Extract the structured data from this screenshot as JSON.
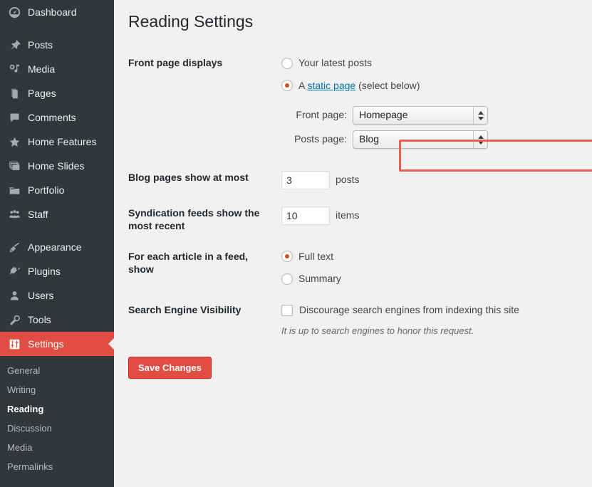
{
  "sidebar": {
    "items": [
      {
        "label": "Dashboard",
        "icon": "dashboard-icon"
      },
      {
        "label": "Posts",
        "icon": "pin-icon"
      },
      {
        "label": "Media",
        "icon": "media-icon"
      },
      {
        "label": "Pages",
        "icon": "pages-icon"
      },
      {
        "label": "Comments",
        "icon": "comment-icon"
      },
      {
        "label": "Home Features",
        "icon": "star-icon"
      },
      {
        "label": "Home Slides",
        "icon": "images-icon"
      },
      {
        "label": "Portfolio",
        "icon": "folder-icon"
      },
      {
        "label": "Staff",
        "icon": "group-icon"
      },
      {
        "label": "Appearance",
        "icon": "paintbrush-icon"
      },
      {
        "label": "Plugins",
        "icon": "plug-icon"
      },
      {
        "label": "Users",
        "icon": "user-icon"
      },
      {
        "label": "Tools",
        "icon": "wrench-icon"
      },
      {
        "label": "Settings",
        "icon": "sliders-icon"
      }
    ],
    "current_item": "Settings",
    "submenu": [
      "General",
      "Writing",
      "Reading",
      "Discussion",
      "Media",
      "Permalinks"
    ],
    "active_submenu": "Reading",
    "highlight_color": "#e14d43",
    "background_color": "#32373c"
  },
  "page": {
    "title": "Reading Settings"
  },
  "front_page_displays": {
    "label": "Front page displays",
    "option_latest": "Your latest posts",
    "option_static_prefix": "A ",
    "option_static_link": "static page",
    "option_static_suffix": " (select below)",
    "selected": "static page",
    "front_page_label": "Front page:",
    "front_page_value": "Homepage",
    "posts_page_label": "Posts page:",
    "posts_page_value": "Blog",
    "annotation_color": "#e8604f"
  },
  "blog_pages": {
    "label": "Blog pages show at most",
    "value": "3",
    "unit": "posts"
  },
  "syndication": {
    "label": "Syndication feeds show the most recent",
    "value": "10",
    "unit": "items"
  },
  "feed_article": {
    "label": "For each article in a feed, show",
    "option_full": "Full text",
    "option_summary": "Summary",
    "selected": "Full text"
  },
  "search_visibility": {
    "label": "Search Engine Visibility",
    "checkbox_label": "Discourage search engines from indexing this site",
    "checked": false,
    "hint": "It is up to search engines to honor this request."
  },
  "submit": {
    "save_label": "Save Changes",
    "color": "#e14d43"
  }
}
